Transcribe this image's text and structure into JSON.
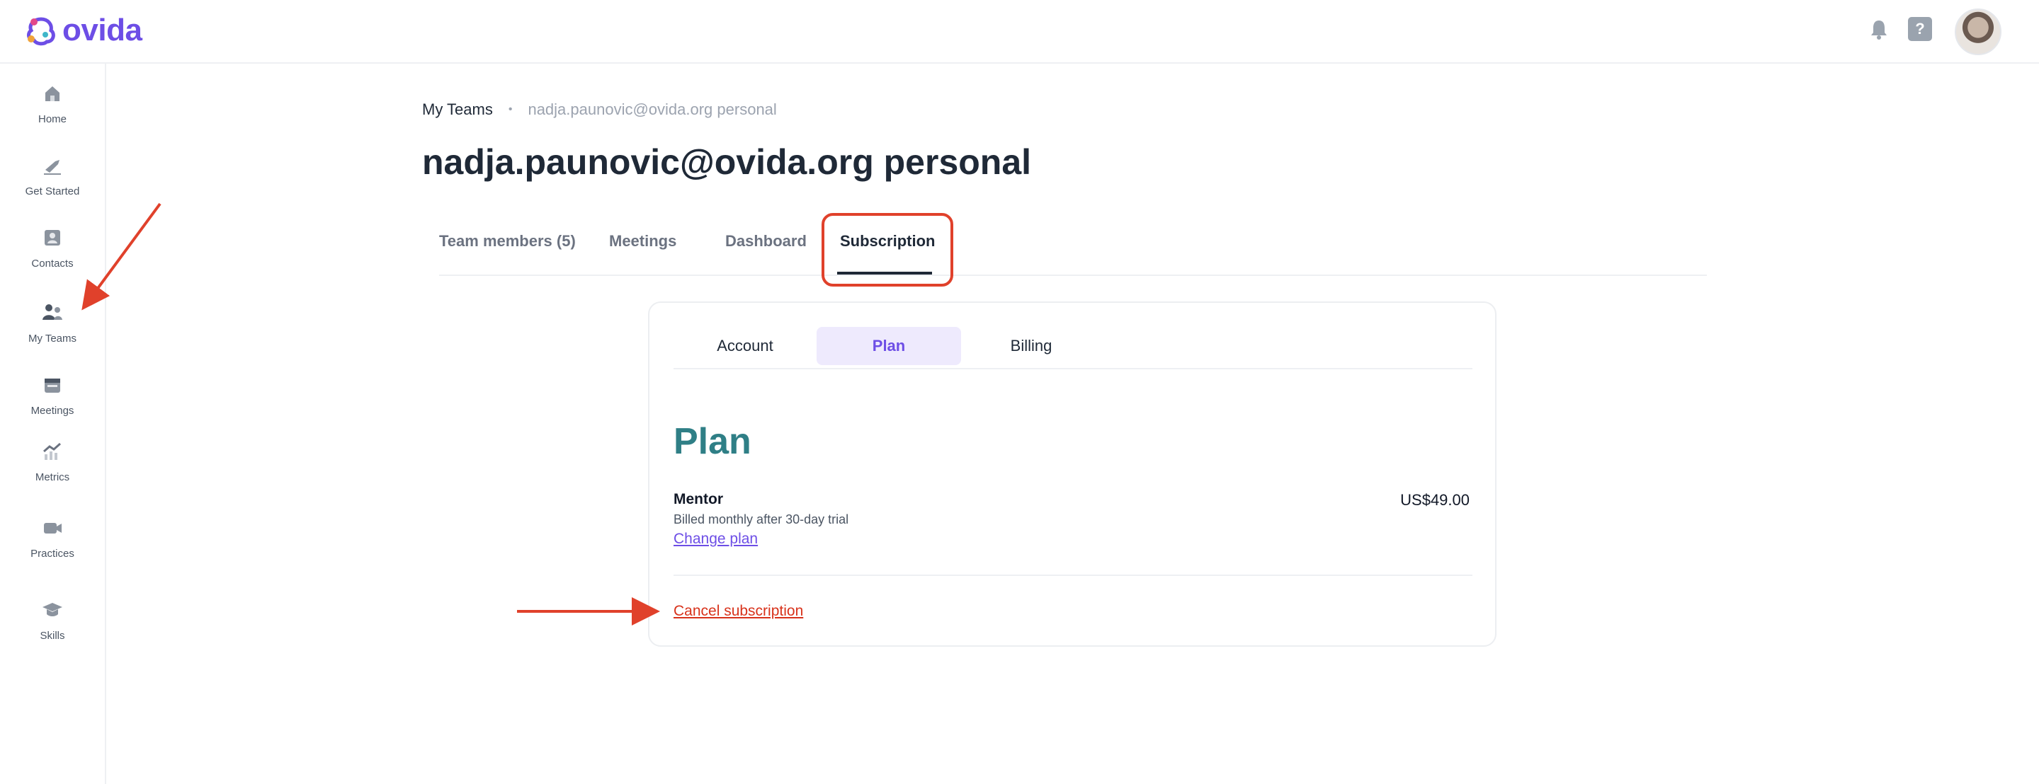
{
  "brand": {
    "name": "ovida",
    "accent": "#6d4ee6"
  },
  "header": {
    "icons": [
      "bell-icon",
      "help-icon",
      "avatar"
    ],
    "help_glyph": "?"
  },
  "sidebar": {
    "items": [
      {
        "label": "Home",
        "icon": "home-icon"
      },
      {
        "label": "Get Started",
        "icon": "rocket-icon"
      },
      {
        "label": "Contacts",
        "icon": "contact-card-icon"
      },
      {
        "label": "My Teams",
        "icon": "team-icon"
      },
      {
        "label": "Meetings",
        "icon": "calendar-icon"
      },
      {
        "label": "Metrics",
        "icon": "chart-icon"
      },
      {
        "label": "Practices",
        "icon": "video-camera-icon"
      },
      {
        "label": "Skills",
        "icon": "graduation-cap-icon"
      }
    ]
  },
  "breadcrumb": {
    "root": "My Teams",
    "separator": "•",
    "current": "nadja.paunovic@ovida.org personal"
  },
  "page_title": "nadja.paunovic@ovida.org personal",
  "tabs": [
    {
      "label": "Team members (5)"
    },
    {
      "label": "Meetings"
    },
    {
      "label": "Dashboard"
    },
    {
      "label": "Subscription",
      "active": true
    }
  ],
  "subscription": {
    "subtabs": [
      {
        "label": "Account"
      },
      {
        "label": "Plan",
        "active": true
      },
      {
        "label": "Billing"
      }
    ],
    "heading": "Plan",
    "plan": {
      "name": "Mentor",
      "billing": "Billed monthly after 30-day trial",
      "price": "US$49.00",
      "change_label": "Change plan"
    },
    "cancel_label": "Cancel subscription"
  },
  "colors": {
    "annotation": "#e0412b",
    "heading_teal": "#2f7f86",
    "danger": "#d8321b"
  }
}
